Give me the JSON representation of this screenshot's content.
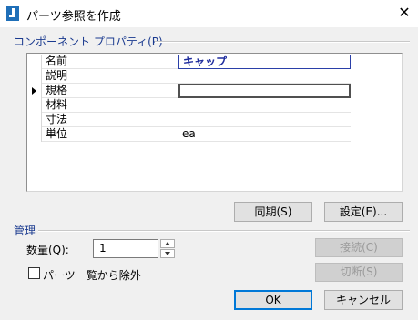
{
  "window": {
    "title": "パーツ参照を作成",
    "close_glyph": "✕"
  },
  "properties_section": {
    "label": "コンポーネント プロパティ(P)",
    "rows": [
      {
        "name": "名前",
        "value": "キャップ"
      },
      {
        "name": "説明",
        "value": ""
      },
      {
        "name": "規格",
        "value": ""
      },
      {
        "name": "材料",
        "value": ""
      },
      {
        "name": "寸法",
        "value": ""
      },
      {
        "name": "単位",
        "value": "ea"
      }
    ]
  },
  "property_buttons": {
    "sync": "同期(S)",
    "settings": "設定(E)..."
  },
  "manage_section": {
    "label": "管理",
    "quantity_label": "数量(Q):",
    "quantity_value": "1",
    "connect_button": "接続(C)",
    "disconnect_button": "切断(S)",
    "exclude_label": "パーツ一覧から除外",
    "exclude_checked": false
  },
  "dialog_buttons": {
    "ok": "OK",
    "cancel": "キャンセル"
  },
  "colors": {
    "section_label": "#1a3a8f",
    "default_button_border": "#0078d7",
    "edit_text": "#1f2d9e"
  }
}
